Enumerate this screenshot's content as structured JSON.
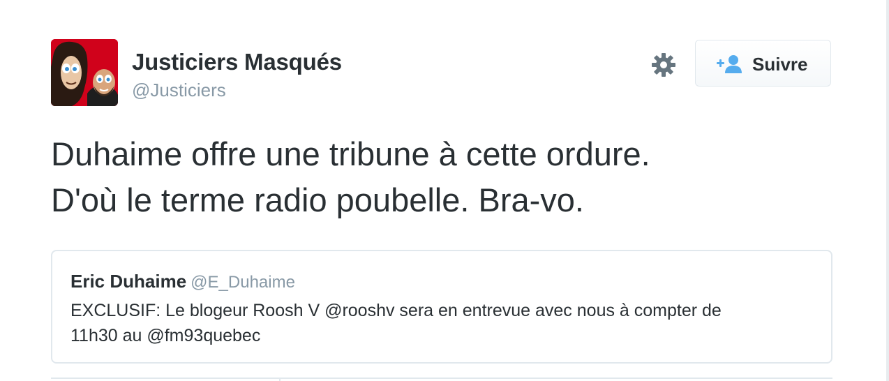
{
  "tweet": {
    "author": {
      "name": "Justiciers Masqués",
      "handle": "@Justiciers"
    },
    "text_lines": [
      "Duhaime offre une tribune à cette ordure.",
      "D'où le terme radio poubelle. Bra-vo."
    ],
    "follow_button": {
      "label": "Suivre",
      "icon": "follow-person-plus-icon"
    },
    "settings_icon": "gear-icon",
    "quoted_tweet": {
      "name": "Eric Duhaime",
      "handle": "@E_Duhaime",
      "text_lines": [
        "EXCLUSIF: Le blogeur Roosh V @rooshv sera en entrevue avec nous à compter de",
        "11h30 au @fm93quebec"
      ]
    }
  },
  "colors": {
    "text_primary": "#292f33",
    "text_secondary": "#8899a6",
    "accent_blue": "#55acee",
    "border": "#e1e8ed",
    "avatar_background": "#d0021b"
  }
}
